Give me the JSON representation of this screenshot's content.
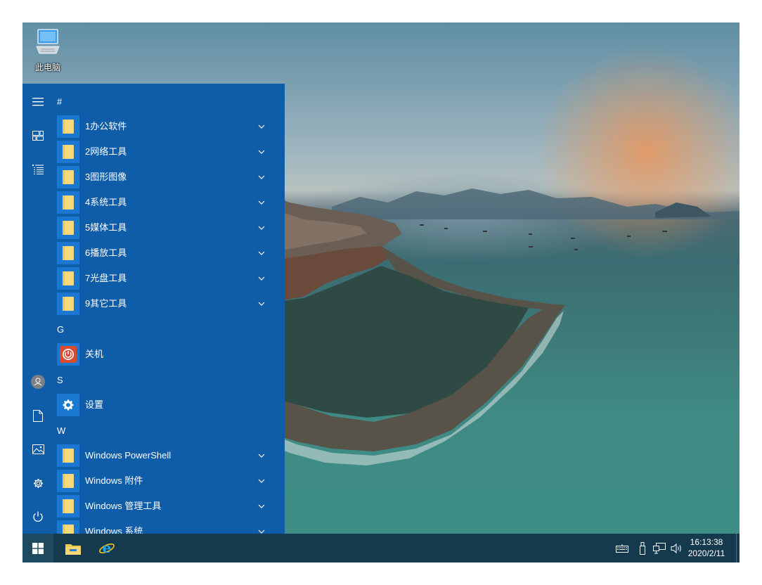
{
  "desktop": {
    "icons": [
      {
        "label": "此电脑",
        "icon": "computer-icon"
      }
    ]
  },
  "start_menu": {
    "rail": [
      {
        "name": "hamburger-menu-icon"
      },
      {
        "name": "tiles-icon"
      },
      {
        "name": "list-icon"
      },
      {
        "name": "user-avatar-icon"
      },
      {
        "name": "documents-icon"
      },
      {
        "name": "pictures-icon"
      },
      {
        "name": "settings-icon"
      },
      {
        "name": "power-icon"
      }
    ],
    "groups": [
      {
        "header": "#",
        "items": [
          {
            "label": "1办公软件",
            "icon": "folder-icon",
            "expandable": true
          },
          {
            "label": "2网络工具",
            "icon": "folder-icon",
            "expandable": true
          },
          {
            "label": "3图形图像",
            "icon": "folder-icon",
            "expandable": true
          },
          {
            "label": "4系统工具",
            "icon": "folder-icon",
            "expandable": true
          },
          {
            "label": "5媒体工具",
            "icon": "folder-icon",
            "expandable": true
          },
          {
            "label": "6播放工具",
            "icon": "folder-icon",
            "expandable": true
          },
          {
            "label": "7光盘工具",
            "icon": "folder-icon",
            "expandable": true
          },
          {
            "label": "9其它工具",
            "icon": "folder-icon",
            "expandable": true
          }
        ]
      },
      {
        "header": "G",
        "items": [
          {
            "label": "关机",
            "icon": "shutdown-icon",
            "expandable": false
          }
        ]
      },
      {
        "header": "S",
        "items": [
          {
            "label": "设置",
            "icon": "gear-icon",
            "expandable": false
          }
        ]
      },
      {
        "header": "W",
        "items": [
          {
            "label": "Windows PowerShell",
            "icon": "folder-icon",
            "expandable": true
          },
          {
            "label": "Windows 附件",
            "icon": "folder-icon",
            "expandable": true
          },
          {
            "label": "Windows 管理工具",
            "icon": "folder-icon",
            "expandable": true
          },
          {
            "label": "Windows 系统",
            "icon": "folder-icon",
            "expandable": true
          }
        ]
      }
    ]
  },
  "taskbar": {
    "pinned": [
      {
        "name": "start-button",
        "icon": "windows-logo-icon"
      },
      {
        "name": "file-explorer-button",
        "icon": "file-explorer-icon"
      },
      {
        "name": "internet-explorer-button",
        "icon": "internet-explorer-icon"
      }
    ],
    "tray": [
      {
        "name": "keyboard-icon"
      },
      {
        "name": "usb-icon"
      },
      {
        "name": "network-icon"
      },
      {
        "name": "volume-icon"
      }
    ],
    "clock": {
      "time": "16:13:38",
      "date": "2020/2/11"
    }
  },
  "colors": {
    "start_menu_bg": "#0f5ca8",
    "tile_bg": "#1a78d2",
    "taskbar_bg": "#153a4d",
    "folder_yellow": "#f6d97a"
  }
}
